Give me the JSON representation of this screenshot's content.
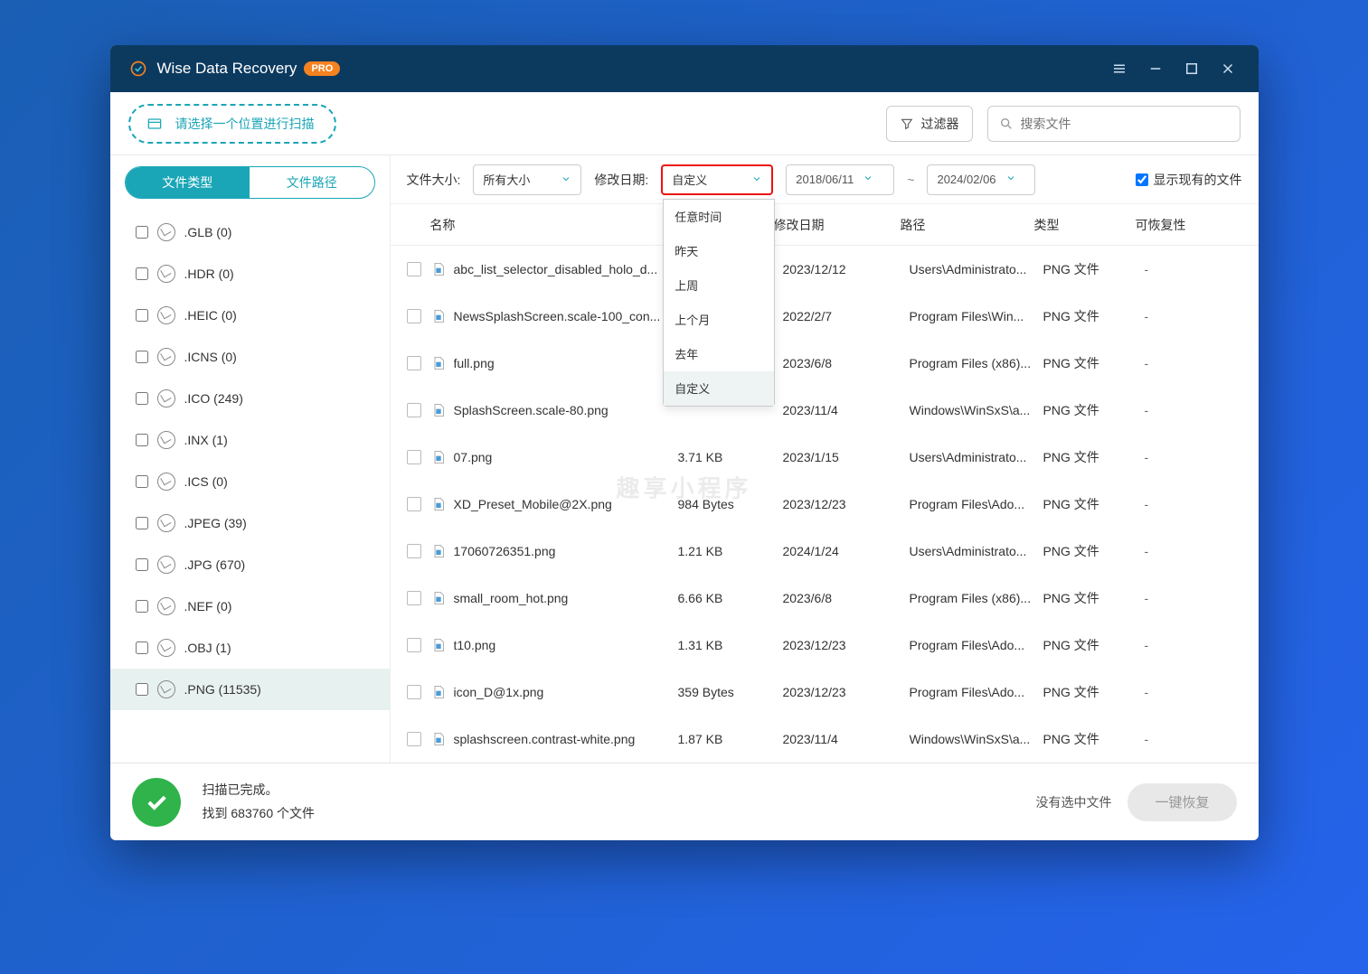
{
  "titlebar": {
    "app_name": "Wise Data Recovery",
    "pro": "PRO"
  },
  "toolbar": {
    "scan_hint": "请选择一个位置进行扫描",
    "filter_btn": "过滤器",
    "search_placeholder": "搜索文件"
  },
  "sidebar": {
    "tab_type": "文件类型",
    "tab_path": "文件路径",
    "items": [
      {
        "label": ".GLB (0)"
      },
      {
        "label": ".HDR (0)"
      },
      {
        "label": ".HEIC (0)"
      },
      {
        "label": ".ICNS (0)"
      },
      {
        "label": ".ICO (249)"
      },
      {
        "label": ".INX (1)"
      },
      {
        "label": ".ICS (0)"
      },
      {
        "label": ".JPEG (39)"
      },
      {
        "label": ".JPG (670)"
      },
      {
        "label": ".NEF (0)"
      },
      {
        "label": ".OBJ (1)"
      },
      {
        "label": ".PNG (11535)",
        "selected": true
      }
    ]
  },
  "filters": {
    "size_label": "文件大小:",
    "size_value": "所有大小",
    "date_label": "修改日期:",
    "date_value": "自定义",
    "date_options": [
      "任意时间",
      "昨天",
      "上周",
      "上个月",
      "去年",
      "自定义"
    ],
    "date_selected_option": "自定义",
    "date_from": "2018/06/11",
    "date_sep": "~",
    "date_to": "2024/02/06",
    "show_existing": "显示现有的文件"
  },
  "columns": {
    "name": "名称",
    "size": "",
    "date": "修改日期",
    "path": "路径",
    "type": "类型",
    "rec": "可恢复性"
  },
  "files": [
    {
      "name": "abc_list_selector_disabled_holo_d...",
      "size": "",
      "date": "2023/12/12",
      "path": "Users\\Administrato...",
      "type": "PNG 文件",
      "rec": "-"
    },
    {
      "name": "NewsSplashScreen.scale-100_con...",
      "size": "",
      "date": "2022/2/7",
      "path": "Program Files\\Win...",
      "type": "PNG 文件",
      "rec": "-"
    },
    {
      "name": "full.png",
      "size": "",
      "date": "2023/6/8",
      "path": "Program Files (x86)...",
      "type": "PNG 文件",
      "rec": "-"
    },
    {
      "name": "SplashScreen.scale-80.png",
      "size": "",
      "date": "2023/11/4",
      "path": "Windows\\WinSxS\\a...",
      "type": "PNG 文件",
      "rec": "-"
    },
    {
      "name": "07.png",
      "size": "3.71 KB",
      "date": "2023/1/15",
      "path": "Users\\Administrato...",
      "type": "PNG 文件",
      "rec": "-"
    },
    {
      "name": "XD_Preset_Mobile@2X.png",
      "size": "984 Bytes",
      "date": "2023/12/23",
      "path": "Program Files\\Ado...",
      "type": "PNG 文件",
      "rec": "-"
    },
    {
      "name": "17060726351.png",
      "size": "1.21 KB",
      "date": "2024/1/24",
      "path": "Users\\Administrato...",
      "type": "PNG 文件",
      "rec": "-"
    },
    {
      "name": "small_room_hot.png",
      "size": "6.66 KB",
      "date": "2023/6/8",
      "path": "Program Files (x86)...",
      "type": "PNG 文件",
      "rec": "-"
    },
    {
      "name": "t10.png",
      "size": "1.31 KB",
      "date": "2023/12/23",
      "path": "Program Files\\Ado...",
      "type": "PNG 文件",
      "rec": "-"
    },
    {
      "name": "icon_D@1x.png",
      "size": "359 Bytes",
      "date": "2023/12/23",
      "path": "Program Files\\Ado...",
      "type": "PNG 文件",
      "rec": "-"
    },
    {
      "name": "splashscreen.contrast-white.png",
      "size": "1.87 KB",
      "date": "2023/11/4",
      "path": "Windows\\WinSxS\\a...",
      "type": "PNG 文件",
      "rec": "-"
    }
  ],
  "status": {
    "done": "扫描已完成。",
    "found": "找到 683760 个文件",
    "no_selection": "没有选中文件",
    "recover_btn": "一键恢复"
  },
  "watermark": "趣享小程序"
}
